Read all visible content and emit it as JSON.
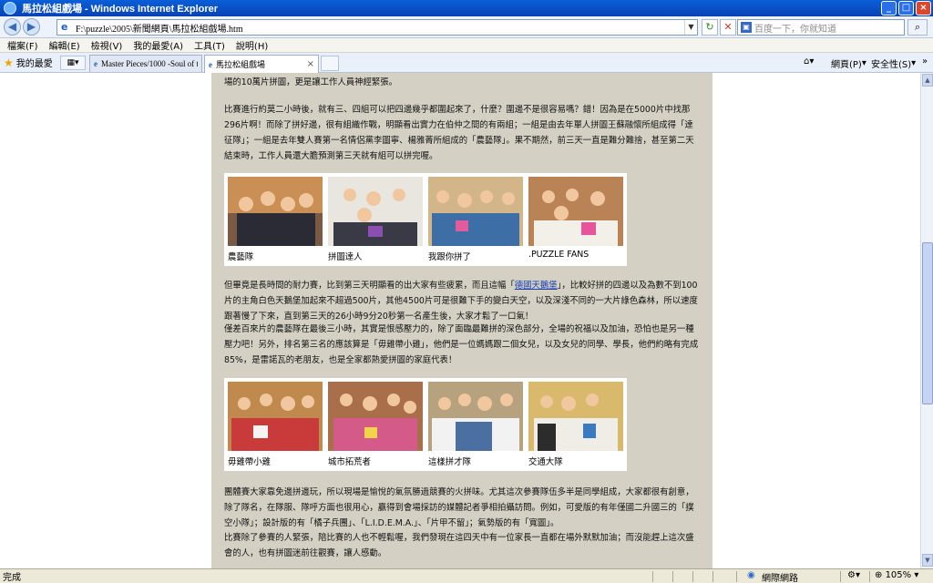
{
  "window": {
    "title": "馬拉松組戲場 - Windows Internet Explorer"
  },
  "address": {
    "url": "F:\\puzzle\\2005\\新聞網頁\\馬拉松組戲場.htm",
    "search_placeholder": "百度一下，你就知道"
  },
  "menu": [
    "檔案(F)",
    "編輯(E)",
    "檢視(V)",
    "我的最愛(A)",
    "工具(T)",
    "說明(H)"
  ],
  "favorites": {
    "label": "我的最愛"
  },
  "tabs": [
    {
      "label": "Master Pieces/1000 -Soul of t..."
    },
    {
      "label": "馬拉松組戲場"
    }
  ],
  "commands": {
    "page": "網頁(P)",
    "safety": "安全性(S)"
  },
  "content": {
    "p0": "場的10萬片拼圖，更是讓工作人員神經緊張。",
    "p1": "比賽進行約莫二小時後，就有三、四組可以把四邊幾乎都圍起來了，什麼？圍邊不是很容易嗎？錯！因為是在5000片中找那296片啊！而除了拼好邊，很有組織作戰，明顯看出實力在伯仲之間的有兩組；一組是由去年單人拼圖王蘇融懷所組成得「達征隊」；一組是去年雙人賽第一名情侶黨李圖寧、楊雅菁所組成的「農藝隊」。果不期然，前三天一直是難分難捨，甚至第二天結束時，工作人員還大膽預測第三天就有組可以拼完喔。",
    "set1": [
      "農藝隊",
      "拼圖達人",
      "我跟你拼了",
      ".PUZZLE FANS"
    ],
    "p2_before": "但畢竟是長時間的耐力賽，比到第三天明顯看的出大家有些疲累，而且這幅「",
    "p2_link": "德國天鵝堡",
    "p2_after": "」，比較好拼的四邊以及為數不到100片的主角白色天鵝堡加起來不超過500片，其他4500片可是很難下手的變白天空，以及深淺不同的一大片綠色森林，所以速度跟著慢了下來，直到第三天的26小時9分20秒第一名產生後，大家才鬆了一口氣！",
    "p3": "僅差百來片的農藝隊在最後三小時，其實是恨感壓力的，除了面臨最難拼的深色部分，全場的祝福以及加油，恐怕也是另一種壓力吧！另外，排名第三名的應該算是「毋雞帶小雞」，他們是一位媽媽跟二個女兒，以及女兒的同學、學長，他們約略有完成85%，是雷諾瓦的老朋友，也是全家都熱愛拼圖的家庭代表！",
    "set2": [
      "毋雞帶小雞",
      "城市拓荒者",
      "這樣拼才隊",
      "交通大隊"
    ],
    "p4": "團體賽大家靠免邊拼邊玩，所以現場是愉悅的氣氛勝過競賽的火拼味。尤其這次參賽隊伍多半是同學組成，大家都很有創意，除了隊名，在隊服、隊呼方面也很用心，贏得到會場採訪的媒體記者爭相拍攝訪問。例如，可愛版的有年僅國二升國三的「撲空小隊」；設計版的有「橘子兵團」、「L.I.D.E.M.A.」、「片甲不留」；氣勢版的有「寬圖」。",
    "p5": "比賽除了參賽的人緊張，陪比賽的人也不輕鬆喔，我們發現在這四天中有一位家長一直都在場外默默加油；而沒能趕上這次盛會的人，也有拼圖迷前往觀賽，讓人感動。"
  },
  "status": {
    "left": "完成",
    "zone": "網際網路",
    "zoom": "105%"
  },
  "colors": {
    "page_bg": "#d4d0c4",
    "link": "#1a3db0",
    "titlebar": "#0a5fd8"
  }
}
